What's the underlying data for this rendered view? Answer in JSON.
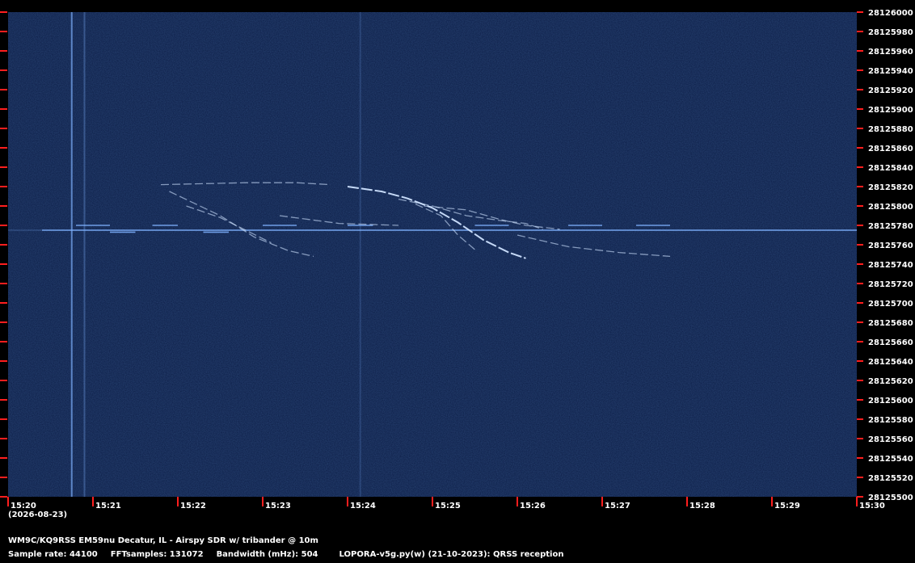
{
  "chart_data": {
    "type": "heatmap",
    "title": "",
    "xlabel": "",
    "ylabel": "",
    "x_ticks": [
      "15:20",
      "15:21",
      "15:22",
      "15:23",
      "15:24",
      "15:25",
      "15:26",
      "15:27",
      "15:28",
      "15:29",
      "15:30"
    ],
    "y_ticks": [
      28126000,
      28125980,
      28125960,
      28125940,
      28125920,
      28125900,
      28125880,
      28125860,
      28125840,
      28125820,
      28125800,
      28125780,
      28125760,
      28125740,
      28125720,
      28125700,
      28125680,
      28125660,
      28125640,
      28125620,
      28125600,
      28125580,
      28125560,
      28125540,
      28125520,
      28125500
    ],
    "x_range_minutes": [
      0,
      10
    ],
    "y_range": [
      28125500,
      28126000
    ],
    "grid": false,
    "background_color": "#0b1c45",
    "signal_color": "#7fb2ff",
    "tick_color": "#ff1e1e",
    "carrier": {
      "freq": 28125775,
      "start_min": 0.4,
      "end_min": 10.0,
      "steps": [
        {
          "from": 0.8,
          "to": 1.2,
          "offset": 5
        },
        {
          "from": 1.2,
          "to": 1.5,
          "offset": -2
        },
        {
          "from": 1.7,
          "to": 2.0,
          "offset": 5
        },
        {
          "from": 2.3,
          "to": 2.6,
          "offset": -2
        },
        {
          "from": 3.0,
          "to": 3.4,
          "offset": 5
        },
        {
          "from": 4.0,
          "to": 4.3,
          "offset": 5
        },
        {
          "from": 5.5,
          "to": 5.9,
          "offset": 5
        },
        {
          "from": 6.6,
          "to": 7.0,
          "offset": 5
        },
        {
          "from": 7.4,
          "to": 7.8,
          "offset": 5
        }
      ]
    },
    "traces": [
      {
        "name": "",
        "points": [
          [
            1.9,
            28125815
          ],
          [
            2.5,
            28125790
          ],
          [
            2.9,
            28125768
          ],
          [
            3.3,
            28125754
          ],
          [
            3.6,
            28125748
          ]
        ]
      },
      {
        "name": "",
        "points": [
          [
            2.1,
            28125800
          ],
          [
            2.5,
            28125788
          ],
          [
            2.8,
            28125775
          ],
          [
            3.1,
            28125762
          ]
        ]
      },
      {
        "name": "",
        "points": [
          [
            1.8,
            28125822
          ],
          [
            2.8,
            28125824
          ],
          [
            3.4,
            28125824
          ],
          [
            3.8,
            28125822
          ]
        ]
      },
      {
        "name": "",
        "points": [
          [
            3.2,
            28125790
          ],
          [
            3.9,
            28125782
          ],
          [
            4.6,
            28125780
          ]
        ]
      },
      {
        "name": "",
        "points": [
          [
            4.0,
            28125820
          ],
          [
            4.4,
            28125815
          ],
          [
            4.7,
            28125808
          ],
          [
            5.0,
            28125798
          ],
          [
            5.3,
            28125783
          ],
          [
            5.6,
            28125765
          ],
          [
            5.9,
            28125752
          ],
          [
            6.1,
            28125746
          ]
        ]
      },
      {
        "name": "",
        "points": [
          [
            4.6,
            28125807
          ],
          [
            5.0,
            28125800
          ],
          [
            5.4,
            28125790
          ],
          [
            5.8,
            28125785
          ],
          [
            6.1,
            28125782
          ],
          [
            6.3,
            28125776
          ]
        ]
      },
      {
        "name": "",
        "points": [
          [
            4.8,
            28125802
          ],
          [
            5.1,
            28125790
          ],
          [
            5.3,
            28125770
          ],
          [
            5.5,
            28125755
          ]
        ]
      },
      {
        "name": "",
        "points": [
          [
            4.9,
            28125800
          ],
          [
            5.4,
            28125796
          ],
          [
            5.8,
            28125786
          ],
          [
            6.1,
            28125780
          ],
          [
            6.5,
            28125776
          ]
        ]
      },
      {
        "name": "",
        "points": [
          [
            6.0,
            28125770
          ],
          [
            6.6,
            28125758
          ],
          [
            7.2,
            28125752
          ],
          [
            7.8,
            28125748
          ]
        ]
      }
    ],
    "vertical_streaks": [
      {
        "min": 0.75,
        "intensity": 0.95
      },
      {
        "min": 0.9,
        "intensity": 0.45
      },
      {
        "min": 4.15,
        "intensity": 0.25
      }
    ]
  },
  "date": "(2026-08-23)",
  "station": "WM9C/KQ9RSS EM59nu Decatur, IL - Airspy SDR w/ tribander @ 10m",
  "params": {
    "sample_rate": "Sample rate: 44100",
    "fft_samples": "FFTsamples: 131072",
    "bandwidth": "Bandwidth (mHz): 504",
    "software": "LOPORA-v5g.py(w) (21-10-2023): QRSS reception"
  }
}
